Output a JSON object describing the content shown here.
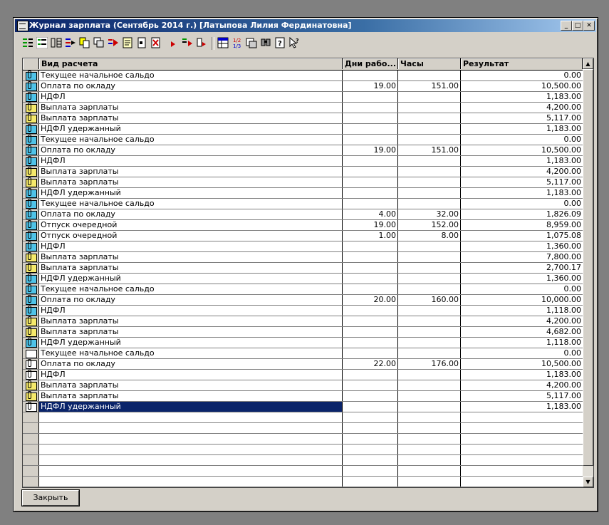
{
  "window": {
    "title": "Журнал зарплата (Сентябрь 2014 г.) [Латыпова Лилия Фердинатовна]",
    "minimize": "_",
    "maximize": "□",
    "close": "✕"
  },
  "toolbar": {
    "icons": [
      "tree-view-icon",
      "list-view-icon",
      "columns-icon",
      "move-right-icon",
      "copy-doc-icon",
      "copy-icon",
      "transfer-icon",
      "note-icon",
      "open-doc-icon",
      "delete-doc-icon",
      "play-icon",
      "filter-icon",
      "step-icon",
      "grid-icon",
      "recalc-icon",
      "print-preview-icon",
      "search-icon",
      "help-icon",
      "pointer-help-icon"
    ]
  },
  "table": {
    "headers": [
      "",
      "Вид расчета",
      "Дни рабо...",
      "Часы",
      "Результат"
    ],
    "rows": [
      {
        "icon": "cyan",
        "name": "Текущее начальное сальдо",
        "days": "",
        "hours": "",
        "result": "0.00"
      },
      {
        "icon": "cyan",
        "name": "Оплата по окладу",
        "days": "19.00",
        "hours": "151.00",
        "result": "10,500.00"
      },
      {
        "icon": "cyan",
        "name": "НДФЛ",
        "days": "",
        "hours": "",
        "result": "1,183.00"
      },
      {
        "icon": "yellow",
        "name": "Выплата зарплаты",
        "days": "",
        "hours": "",
        "result": "4,200.00"
      },
      {
        "icon": "yellow",
        "name": "Выплата зарплаты",
        "days": "",
        "hours": "",
        "result": "5,117.00"
      },
      {
        "icon": "cyan",
        "name": "НДФЛ удержанный",
        "days": "",
        "hours": "",
        "result": "1,183.00"
      },
      {
        "icon": "cyan",
        "name": "Текущее начальное сальдо",
        "days": "",
        "hours": "",
        "result": "0.00"
      },
      {
        "icon": "cyan",
        "name": "Оплата по окладу",
        "days": "19.00",
        "hours": "151.00",
        "result": "10,500.00"
      },
      {
        "icon": "cyan",
        "name": "НДФЛ",
        "days": "",
        "hours": "",
        "result": "1,183.00"
      },
      {
        "icon": "yellow",
        "name": "Выплата зарплаты",
        "days": "",
        "hours": "",
        "result": "4,200.00"
      },
      {
        "icon": "yellow",
        "name": "Выплата зарплаты",
        "days": "",
        "hours": "",
        "result": "5,117.00"
      },
      {
        "icon": "cyan",
        "name": "НДФЛ удержанный",
        "days": "",
        "hours": "",
        "result": "1,183.00"
      },
      {
        "icon": "cyan",
        "name": "Текущее начальное сальдо",
        "days": "",
        "hours": "",
        "result": "0.00"
      },
      {
        "icon": "cyan",
        "name": "Оплата по окладу",
        "days": "4.00",
        "hours": "32.00",
        "result": "1,826.09"
      },
      {
        "icon": "cyan",
        "name": "Отпуск очередной",
        "days": "19.00",
        "hours": "152.00",
        "result": "8,959.00"
      },
      {
        "icon": "cyan",
        "name": "Отпуск очередной",
        "days": "1.00",
        "hours": "8.00",
        "result": "1,075.08"
      },
      {
        "icon": "cyan",
        "name": "НДФЛ",
        "days": "",
        "hours": "",
        "result": "1,360.00"
      },
      {
        "icon": "yellow",
        "name": "Выплата зарплаты",
        "days": "",
        "hours": "",
        "result": "7,800.00"
      },
      {
        "icon": "yellow",
        "name": "Выплата зарплаты",
        "days": "",
        "hours": "",
        "result": "2,700.17"
      },
      {
        "icon": "cyan",
        "name": "НДФЛ удержанный",
        "days": "",
        "hours": "",
        "result": "1,360.00"
      },
      {
        "icon": "cyan",
        "name": "Текущее начальное сальдо",
        "days": "",
        "hours": "",
        "result": "0.00"
      },
      {
        "icon": "cyan",
        "name": "Оплата по окладу",
        "days": "20.00",
        "hours": "160.00",
        "result": "10,000.00"
      },
      {
        "icon": "cyan",
        "name": "НДФЛ",
        "days": "",
        "hours": "",
        "result": "1,118.00"
      },
      {
        "icon": "yellow",
        "name": "Выплата зарплаты",
        "days": "",
        "hours": "",
        "result": "4,200.00"
      },
      {
        "icon": "yellow",
        "name": "Выплата зарплаты",
        "days": "",
        "hours": "",
        "result": "4,682.00"
      },
      {
        "icon": "cyan",
        "name": "НДФЛ удержанный",
        "days": "",
        "hours": "",
        "result": "1,118.00"
      },
      {
        "icon": "white-plain",
        "name": "Текущее начальное сальдо",
        "days": "",
        "hours": "",
        "result": "0.00"
      },
      {
        "icon": "white",
        "name": "Оплата по окладу",
        "days": "22.00",
        "hours": "176.00",
        "result": "10,500.00"
      },
      {
        "icon": "white",
        "name": "НДФЛ",
        "days": "",
        "hours": "",
        "result": "1,183.00"
      },
      {
        "icon": "yellow",
        "name": "Выплата зарплаты",
        "days": "",
        "hours": "",
        "result": "4,200.00"
      },
      {
        "icon": "yellow",
        "name": "Выплата зарплаты",
        "days": "",
        "hours": "",
        "result": "5,117.00"
      },
      {
        "icon": "white",
        "name": "НДФЛ удержанный",
        "days": "",
        "hours": "",
        "result": "1,183.00",
        "selected": true
      }
    ],
    "empty_rows": 8
  },
  "footer": {
    "close_label": "Закрыть"
  }
}
